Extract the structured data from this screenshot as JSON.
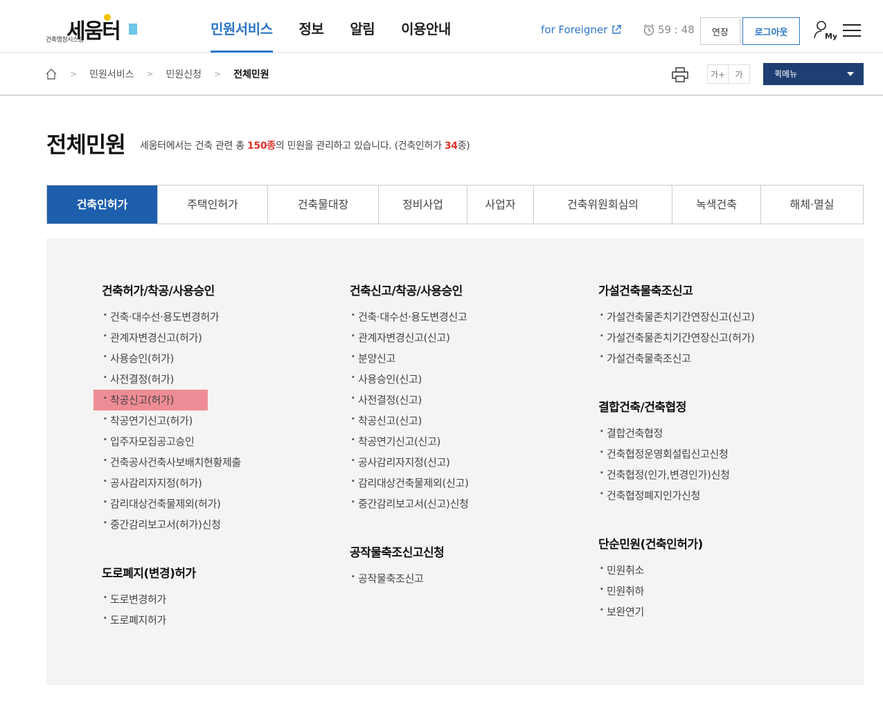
{
  "header": {
    "logo_text": "세움터",
    "logo_sub": "건축행정시스템",
    "nav": [
      "민원서비스",
      "정보",
      "알림",
      "이용안내"
    ],
    "active_nav": 0,
    "foreigner_label": "for Foreigner",
    "timer": "59 : 48",
    "extend_label": "연장",
    "logout_label": "로그아웃"
  },
  "breadcrumb": {
    "items": [
      "민원서비스",
      "민원신청"
    ],
    "current": "전체민원",
    "font_up": "가+",
    "font_down": "가",
    "quick_menu": "퀵메뉴"
  },
  "page": {
    "title": "전체민원",
    "desc_pre": "세움터에서는 건축 관련 총 ",
    "desc_total": "150종",
    "desc_mid": "의 민원을 관리하고 있습니다. (건축인허가 ",
    "desc_count": "34",
    "desc_post": "종)"
  },
  "tabs": [
    "건축인허가",
    "주택인허가",
    "건축물대장",
    "정비사업",
    "사업자",
    "건축위원회심의",
    "녹색건축",
    "해체·멸실"
  ],
  "groups": {
    "g1": {
      "title": "건축허가/착공/사용승인",
      "items": [
        "건축·대수선·용도변경허가",
        "관계자변경신고(허가)",
        "사용승인(허가)",
        "사전결정(허가)",
        "착공신고(허가)",
        "착공연기신고(허가)",
        "입주자모집공고승인",
        "건축공사건축사보배치현황제출",
        "공사감리자지정(허가)",
        "감리대상건축물제외(허가)",
        "중간감리보고서(허가)신청"
      ]
    },
    "g2": {
      "title": "도로폐지(변경)허가",
      "items": [
        "도로변경허가",
        "도로폐지허가"
      ]
    },
    "g3": {
      "title": "건축신고/착공/사용승인",
      "items": [
        "건축·대수선·용도변경신고",
        "관계자변경신고(신고)",
        "분양신고",
        "사용승인(신고)",
        "사전결정(신고)",
        "착공신고(신고)",
        "착공연기신고(신고)",
        "공사감리자지정(신고)",
        "감리대상건축물제외(신고)",
        "중간감리보고서(신고)신청"
      ]
    },
    "g4": {
      "title": "공작물축조신고신청",
      "items": [
        "공작물축조신고"
      ]
    },
    "g5": {
      "title": "가설건축물축조신고",
      "items": [
        "가설건축물존치기간연장신고(신고)",
        "가설건축물존치기간연장신고(허가)",
        "가설건축물축조신고"
      ]
    },
    "g6": {
      "title": "결합건축/건축협정",
      "items": [
        "결합건축협정",
        "건축협정운영회설립신고신청",
        "건축협정(인가,변경인가)신청",
        "건축협정폐지인가신청"
      ]
    },
    "g7": {
      "title": "단순민원(건축인허가)",
      "items": [
        "민원취소",
        "민원취하",
        "보완연기"
      ]
    }
  }
}
